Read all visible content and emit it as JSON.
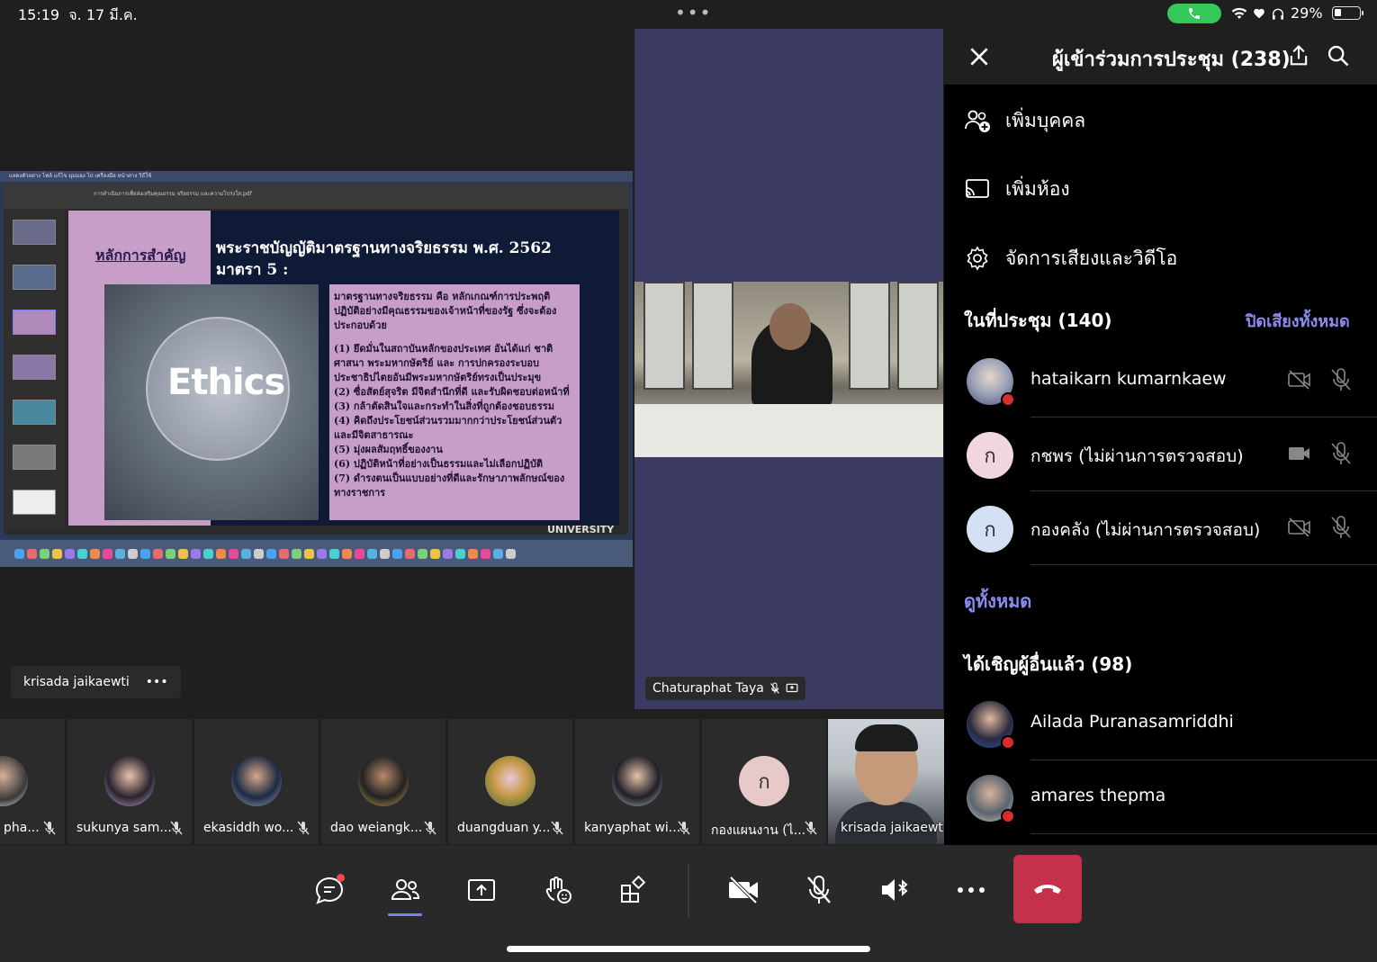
{
  "status_bar": {
    "time": "15:19",
    "date": "จ. 17 มี.ค.",
    "dots": "•••",
    "battery": "29%",
    "battery_level": 0.29
  },
  "shared_screen": {
    "mac_menu": "แสดงตัวอย่าง   ไฟล์   แก้ไข   มุมมอง   ไป   เครื่องมือ   หน้าต่าง   วิธีใช้",
    "pdf_filename": "การดำเนินการเพื่อส่งเสริมคุณธรรม จริยธรรม และความโปร่งใส.pdf",
    "slide_heading": "หลักการสำคัญ",
    "slide_title_line1": "พระราชบัญญัติมาตรฐานทางจริยธรรม พ.ศ. 2562",
    "slide_title_line2": "มาตรา 5 :",
    "ethics_word": "Ethics",
    "slide_body": [
      "มาตรฐานทางจริยธรรม คือ หลักเกณฑ์การประพฤติปฏิบัติอย่างมีคุณธรรมของเจ้าหน้าที่ของรัฐ ซึ่งจะต้องประกอบด้วย",
      "(1) ยึดมั่นในสถาบันหลักของประเทศ อันได้แก่ ชาติ ศาสนา พระมหากษัตริย์ และ การปกครองระบอบประชาธิปไตยอันมีพระมหากษัตริย์ทรงเป็นประมุข",
      "(2) ซื่อสัตย์สุจริต มีจิตสำนึกที่ดี และรับผิดชอบต่อหน้าที่",
      "(3) กล้าตัดสินใจและกระทำในสิ่งที่ถูกต้องชอบธรรม",
      "(4) คิดถึงประโยชน์ส่วนรวมมากกว่าประโยชน์ส่วนตัว และมีจิตสาธารณะ",
      "(5) มุ่งผลสัมฤทธิ์ของงาน",
      "(6) ปฏิบัติหน้าที่อย่างเป็นธรรมและไม่เลือกปฏิบัติ",
      "(7) ดำรงตนเป็นแบบอย่างที่ดีและรักษาภาพลักษณ์ของทางราชการ"
    ],
    "footer_text": "UNIVERSITY",
    "presenter_name": "krisada jaikaewti",
    "presenter_more": "•••"
  },
  "center_video": {
    "name": "Chaturaphat Taya"
  },
  "panel": {
    "title": "ผู้เข้าร่วมการประชุม (238)",
    "actions": [
      {
        "label": "เพิ่มบุคคล",
        "icon": "add-person-icon"
      },
      {
        "label": "เพิ่มห้อง",
        "icon": "cast-room-icon"
      },
      {
        "label": "จัดการเสียงและวิดีโอ",
        "icon": "gear-icon"
      }
    ],
    "in_meeting_title": "ในที่ประชุม (140)",
    "mute_all": "ปิดเสียงทั้งหมด",
    "in_meeting": [
      {
        "name": "hataikarn kumarnkaew",
        "initial": "",
        "camera": "off"
      },
      {
        "name": "กชพร (ไม่ผ่านการตรวจสอบ)",
        "initial": "ก",
        "camera": "on"
      },
      {
        "name": "กองคลัง (ไม่ผ่านการตรวจสอบ)",
        "initial": "ก",
        "camera": "off"
      }
    ],
    "see_all": "ดูทั้งหมด",
    "invited_title": "ได้เชิญผู้อื่นแล้ว (98)",
    "invited": [
      {
        "name": "Ailada Puranasamriddhi"
      },
      {
        "name": "amares thepma"
      }
    ]
  },
  "gallery": [
    {
      "name": "pha...",
      "initial": ""
    },
    {
      "name": "sukunya sam...",
      "initial": ""
    },
    {
      "name": "ekasiddh wo...",
      "initial": ""
    },
    {
      "name": "dao weiangk...",
      "initial": ""
    },
    {
      "name": "duangduan y...",
      "initial": ""
    },
    {
      "name": "kanyaphat wi...",
      "initial": ""
    },
    {
      "name": "กองแผนงาน (ไ...",
      "initial": "ก"
    },
    {
      "name": "krisada jaikaewti",
      "initial": ""
    }
  ],
  "colors": {
    "accent": "#7b83eb",
    "link": "#8b8cf0",
    "end_call": "#c4314b",
    "presence_busy": "#d92c2c",
    "call_pill": "#34c759"
  }
}
